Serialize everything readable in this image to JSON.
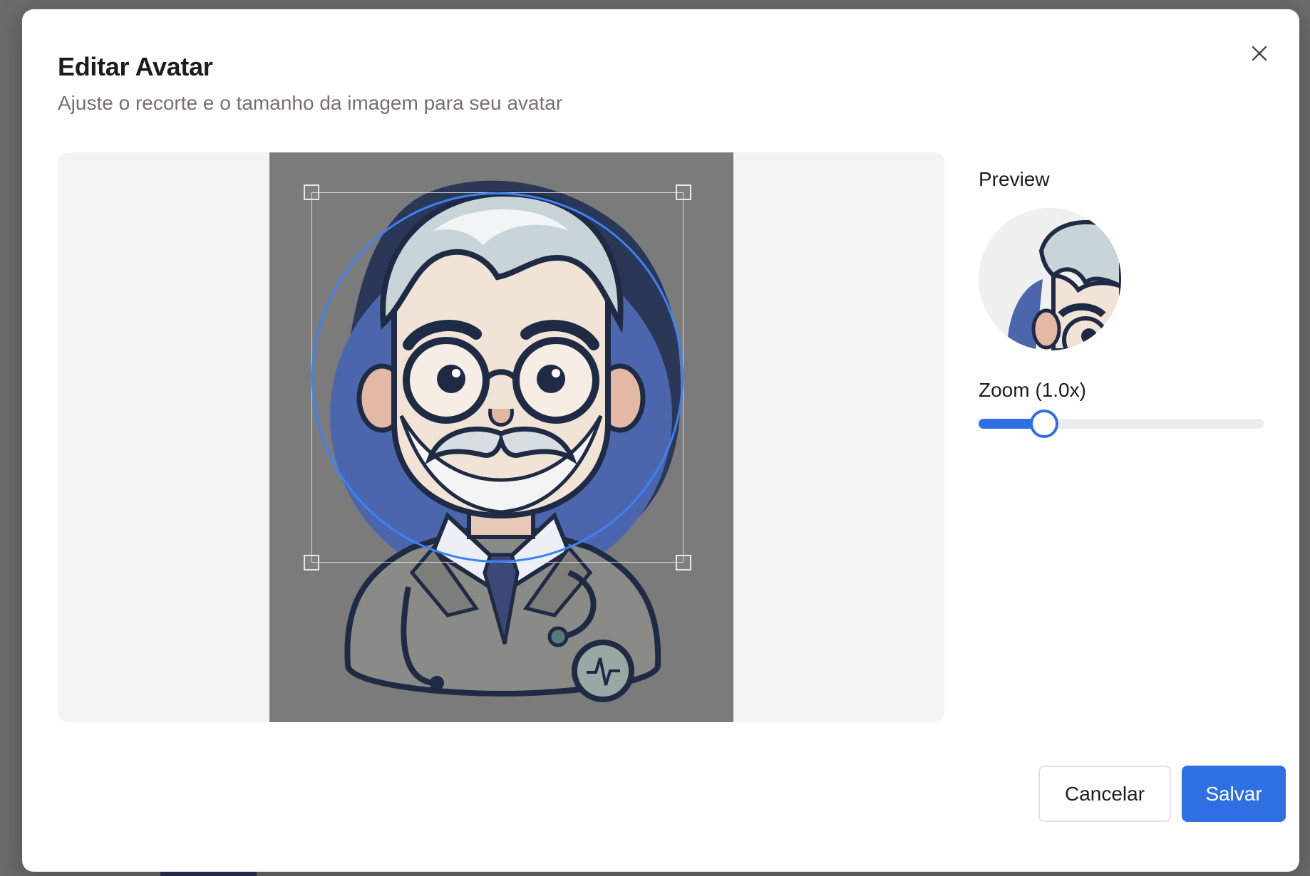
{
  "dialog": {
    "title": "Editar Avatar",
    "subtitle": "Ajuste o recorte e o tamanho da imagem para seu avatar",
    "close_icon": "close-icon"
  },
  "preview": {
    "label": "Preview"
  },
  "zoom": {
    "label": "Zoom (1.0x)",
    "value": 1.0,
    "fraction": 0.23
  },
  "actions": {
    "cancel_label": "Cancelar",
    "save_label": "Salvar"
  },
  "colors": {
    "accent": "#2f6fe4",
    "crop_outline": "#3b82f6",
    "overlay": "#7b7b7b"
  }
}
